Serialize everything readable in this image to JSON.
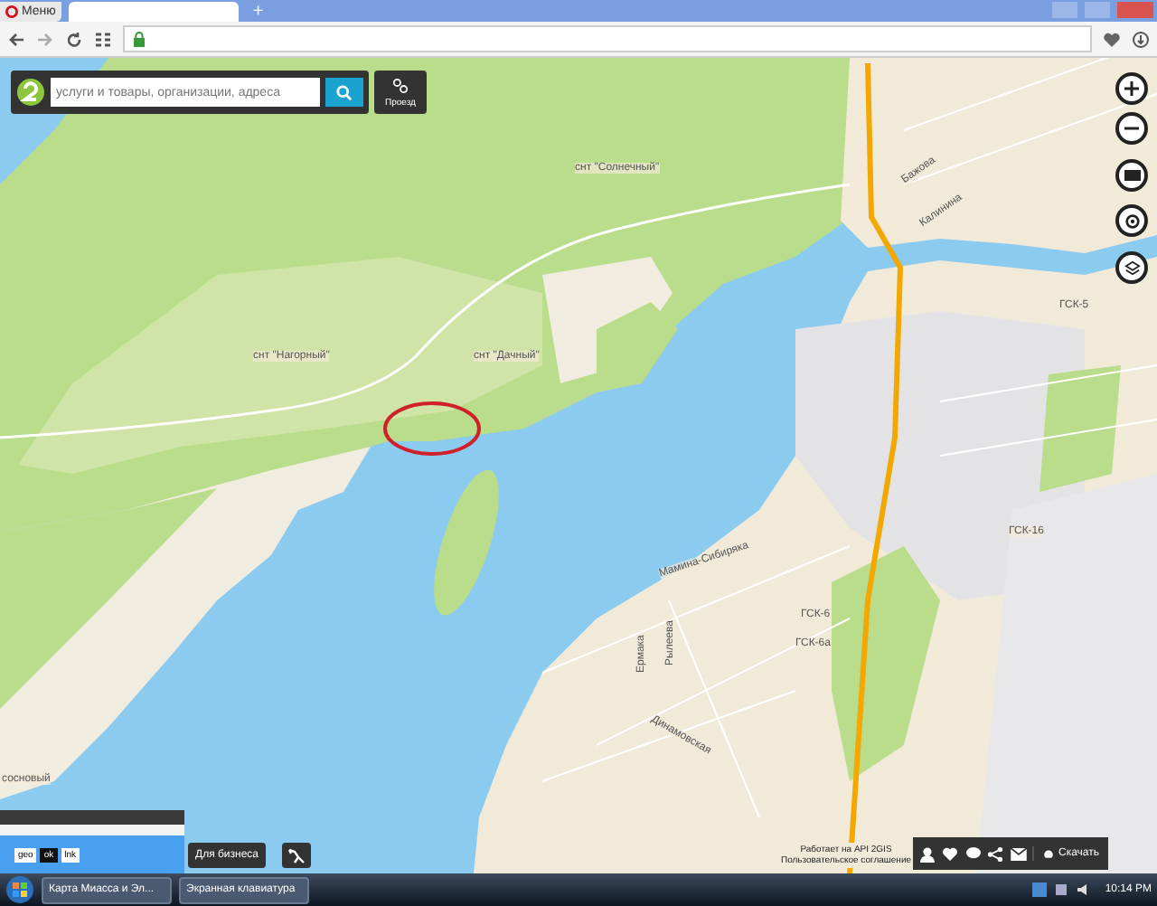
{
  "browser": {
    "menu_label": "Меню",
    "new_tab": "+"
  },
  "search": {
    "placeholder": "услуги и товары, организации, адреса",
    "route_button": "Проезд"
  },
  "map": {
    "labels": [
      {
        "text": "снт \"Солнечный\""
      },
      {
        "text": "снт \"Нагорный\""
      },
      {
        "text": "снт \"Дачный\""
      },
      {
        "text": "Бажова"
      },
      {
        "text": "Калинина"
      },
      {
        "text": "ГСК-5"
      },
      {
        "text": "ГСК-16"
      },
      {
        "text": "Мамина-Сибиряка"
      },
      {
        "text": "ГСК-6"
      },
      {
        "text": "ГСК-6а"
      },
      {
        "text": "Ермака"
      },
      {
        "text": "Рылеева"
      },
      {
        "text": "Динамовская"
      },
      {
        "text": "сосновый"
      }
    ]
  },
  "mini_window": {
    "buttons": [
      "geo",
      "ok",
      "lnk"
    ]
  },
  "business_button": "Для бизнеса",
  "credits": [
    "Работает на API 2GIS",
    "Пользовательское соглашение"
  ],
  "download_button": "Скачать",
  "taskbar": {
    "tasks": [
      "Карта Миасса и Эл...",
      "Экранная клавиатура"
    ],
    "clock": "10:14 PM"
  }
}
